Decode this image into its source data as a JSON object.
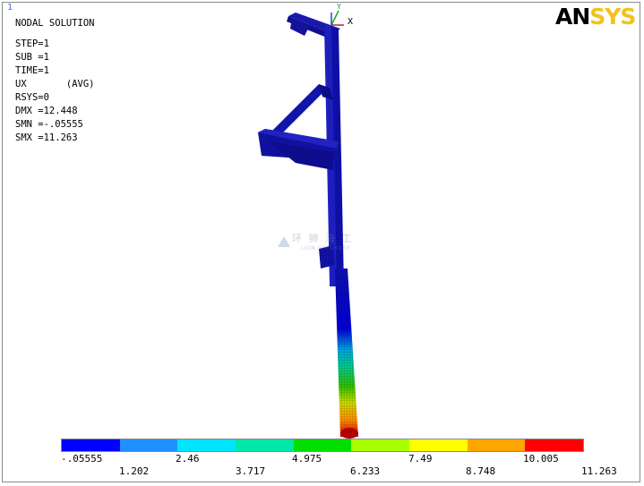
{
  "viewport": {
    "number": "1"
  },
  "info_lines": [
    "NODAL SOLUTION",
    "STEP=1",
    "SUB =1",
    "TIME=1",
    "UX       (AVG)",
    "RSYS=0",
    "DMX =12.448",
    "SMN =-.05555",
    "SMX =11.263"
  ],
  "logo": {
    "left": "AN",
    "right": "SYS",
    "color_an": "#000000",
    "color_sys": "#f2c21a"
  },
  "triad": {
    "x_label": "X",
    "y_label": "Y"
  },
  "watermark": {
    "title": "环 狮 海 工",
    "subtitle": "LION OFFSHORE"
  },
  "legend": {
    "colors": [
      "#0000ff",
      "#1e90ff",
      "#00e5ff",
      "#00e8a8",
      "#00e000",
      "#a8ff00",
      "#ffff00",
      "#ffa500",
      "#ff0000"
    ],
    "labels_top": [
      "-.05555",
      "2.46",
      "4.975",
      "7.49",
      "10.005"
    ],
    "labels_bottom": [
      "1.202",
      "3.717",
      "6.233",
      "8.748",
      "11.263"
    ]
  }
}
